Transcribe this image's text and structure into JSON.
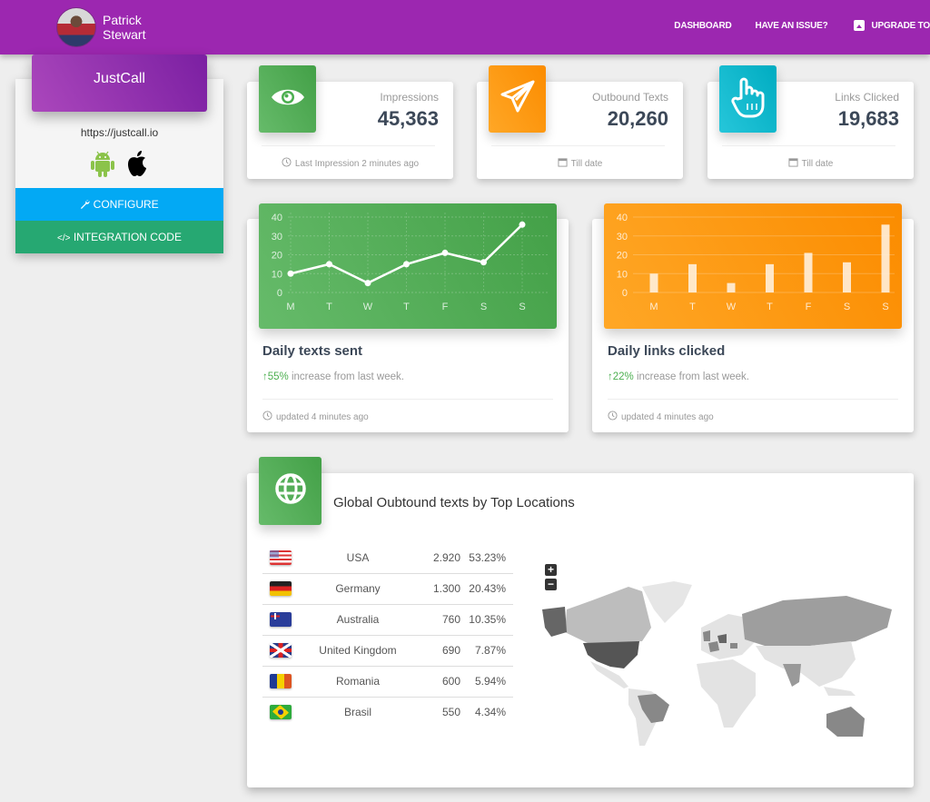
{
  "user": {
    "name_line1": "Patrick",
    "name_line2": "Stewart"
  },
  "nav": {
    "links": [
      {
        "label": "DASHBOARD"
      },
      {
        "label": "HAVE AN ISSUE?"
      },
      {
        "label": "UPGRADE TO",
        "icon": "upgrade-icon"
      }
    ]
  },
  "app": {
    "name": "JustCall",
    "url": "https://justcall.io",
    "platforms": [
      "android-icon",
      "apple-icon"
    ],
    "configure_label": "CONFIGURE",
    "integration_label": "INTEGRATION CODE"
  },
  "stats": [
    {
      "label": "Impressions",
      "value": "45,363",
      "footer": "Last Impression 2 minutes ago",
      "footer_icon": "clock-icon",
      "icon": "eye-icon",
      "color": "#4caf50"
    },
    {
      "label": "Outbound Texts",
      "value": "20,260",
      "footer": "Till date",
      "footer_icon": "calendar-icon",
      "icon": "paper-plane-icon",
      "color": "#ff9800"
    },
    {
      "label": "Links Clicked",
      "value": "19,683",
      "footer": "Till date",
      "footer_icon": "calendar-icon",
      "icon": "hand-pointer-icon",
      "color": "#00bcd4"
    }
  ],
  "charts": [
    {
      "title": "Daily texts sent",
      "change": "55%",
      "change_text": " increase from last week.",
      "footer": "updated 4 minutes ago"
    },
    {
      "title": "Daily links clicked",
      "change": "22%",
      "change_text": " increase from last week.",
      "footer": "updated 4 minutes ago"
    }
  ],
  "chart_data": [
    {
      "type": "line",
      "title": "Daily texts sent",
      "categories": [
        "M",
        "T",
        "W",
        "T",
        "F",
        "S",
        "S"
      ],
      "values": [
        10,
        15,
        5,
        15,
        21,
        16,
        36
      ],
      "yticks": [
        0,
        10,
        20,
        30,
        40
      ],
      "ylim": [
        0,
        40
      ],
      "grid": true,
      "xlabel": "",
      "ylabel": ""
    },
    {
      "type": "bar",
      "title": "Daily links clicked",
      "categories": [
        "M",
        "T",
        "W",
        "T",
        "F",
        "S",
        "S"
      ],
      "values": [
        10,
        15,
        5,
        15,
        21,
        16,
        36
      ],
      "yticks": [
        0,
        10,
        20,
        30,
        40
      ],
      "ylim": [
        0,
        40
      ],
      "grid": true,
      "xlabel": "",
      "ylabel": ""
    }
  ],
  "global": {
    "title": "Global Oubtound texts by Top Locations",
    "locations": [
      {
        "flag": "usa",
        "country": "USA",
        "count": "2.920",
        "percent": "53.23%"
      },
      {
        "flag": "germany",
        "country": "Germany",
        "count": "1.300",
        "percent": "20.43%"
      },
      {
        "flag": "australia",
        "country": "Australia",
        "count": "760",
        "percent": "10.35%"
      },
      {
        "flag": "uk",
        "country": "United Kingdom",
        "count": "690",
        "percent": "7.87%"
      },
      {
        "flag": "romania",
        "country": "Romania",
        "count": "600",
        "percent": "5.94%"
      },
      {
        "flag": "brasil",
        "country": "Brasil",
        "count": "550",
        "percent": "4.34%"
      }
    ],
    "map_zoom_in": "+",
    "map_zoom_out": "−"
  },
  "colors": {
    "primary": "#9c27b0",
    "green": "#4caf50",
    "orange": "#ff9800",
    "cyan": "#00bcd4",
    "configure": "#03a9f4",
    "integration": "#26a872"
  }
}
